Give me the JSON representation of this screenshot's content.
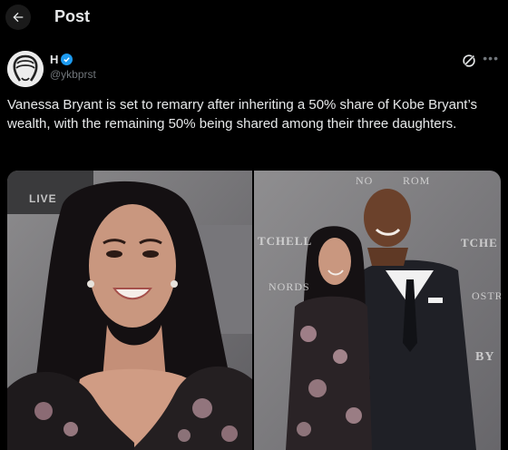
{
  "header": {
    "title": "Post",
    "back_icon": "arrow-left-icon"
  },
  "author": {
    "name": "H",
    "handle": "@ykbprst",
    "verified_color": "#1d9bf0"
  },
  "post": {
    "text": "Vanessa Bryant is set to remarry after inheriting a 50% share of Kobe Bryant’s wealth, with the remaining 50% being shared among their three daughters."
  },
  "media": {
    "left_backdrop": [
      "LIVE"
    ],
    "right_backdrop": [
      "NO",
      "ROM",
      "TCHELL",
      "TCHE",
      "NORDS",
      "OSTR",
      "BY"
    ]
  },
  "colors": {
    "background": "#000000",
    "text": "#e7e9ea",
    "muted": "#71767b",
    "accent": "#1d9bf0"
  }
}
